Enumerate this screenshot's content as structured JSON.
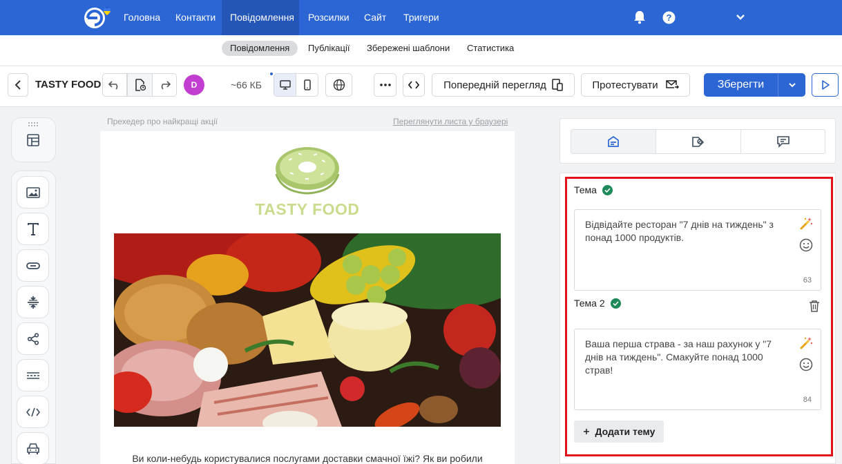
{
  "nav": {
    "items": [
      {
        "label": "Головна"
      },
      {
        "label": "Контакти"
      },
      {
        "label": "Повідомлення",
        "active": true
      },
      {
        "label": "Розсилки"
      },
      {
        "label": "Сайт"
      },
      {
        "label": "Тригери"
      }
    ],
    "icons": [
      "bell-icon",
      "help-icon",
      "chevron-down-icon"
    ]
  },
  "subnav": {
    "items": [
      {
        "label": "Повідомлення",
        "active": true
      },
      {
        "label": "Публікації"
      },
      {
        "label": "Збережені шаблони"
      },
      {
        "label": "Статистика"
      }
    ]
  },
  "toolbar": {
    "campaign_name": "TASTY FOOD",
    "avatar_initial": "D",
    "size": "~66 КБ",
    "preview_label": "Попередній перегляд",
    "test_label": "Протестувати",
    "save_label": "Зберегти"
  },
  "email": {
    "preheader": "Прехедер про найкращі акції",
    "browser_link": "Переглянути листа у браузері",
    "brand": "TASTY FOOD",
    "body_text": "Ви коли-небудь користувалися послугами доставки смачної їжі? Як ви робили"
  },
  "subjects": {
    "label_1": "Тема",
    "text_1": "Відвідайте ресторан \"7 днів на тиждень\" з понад 1000 продуктів.",
    "count_1": "63",
    "label_2": "Тема 2",
    "text_2": "Ваша перша страва - за наш рахунок у \"7 днів на тиждень\". Смакуйте понад 1000 страв!",
    "count_2": "84",
    "add_label": "Додати тему"
  },
  "colors": {
    "brand_blue": "#2b66d4",
    "highlight_red": "#e3111a",
    "check_green": "#1e8a5a",
    "logo_green": "#c9dc8c"
  }
}
